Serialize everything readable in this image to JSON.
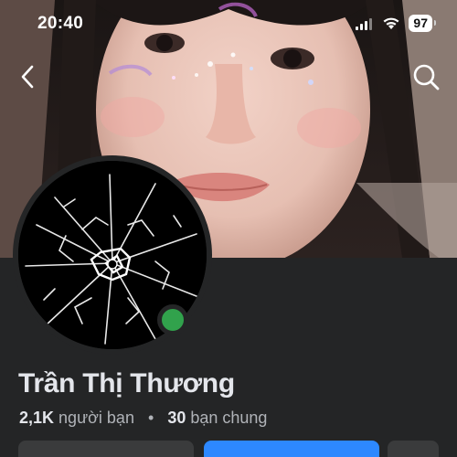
{
  "status_bar": {
    "time": "20:40",
    "battery": "97"
  },
  "nav": {
    "back_icon": "chevron-left-icon",
    "search_icon": "search-icon"
  },
  "profile": {
    "name": "Trần Thị Thương",
    "friends_count": "2,1K",
    "friends_label": "người bạn",
    "separator": "•",
    "mutual_count": "30",
    "mutual_label": "bạn chung",
    "online": true,
    "online_color": "#31a24c",
    "avatar_icon": "shattered-glass-avatar"
  },
  "actions": {
    "friends_icon": "friends-icon",
    "message_icon": "messenger-icon",
    "more_icon": "more-icon"
  },
  "colors": {
    "background": "#242526",
    "primary_button": "#2d88ff",
    "secondary_button": "#3a3b3c"
  }
}
